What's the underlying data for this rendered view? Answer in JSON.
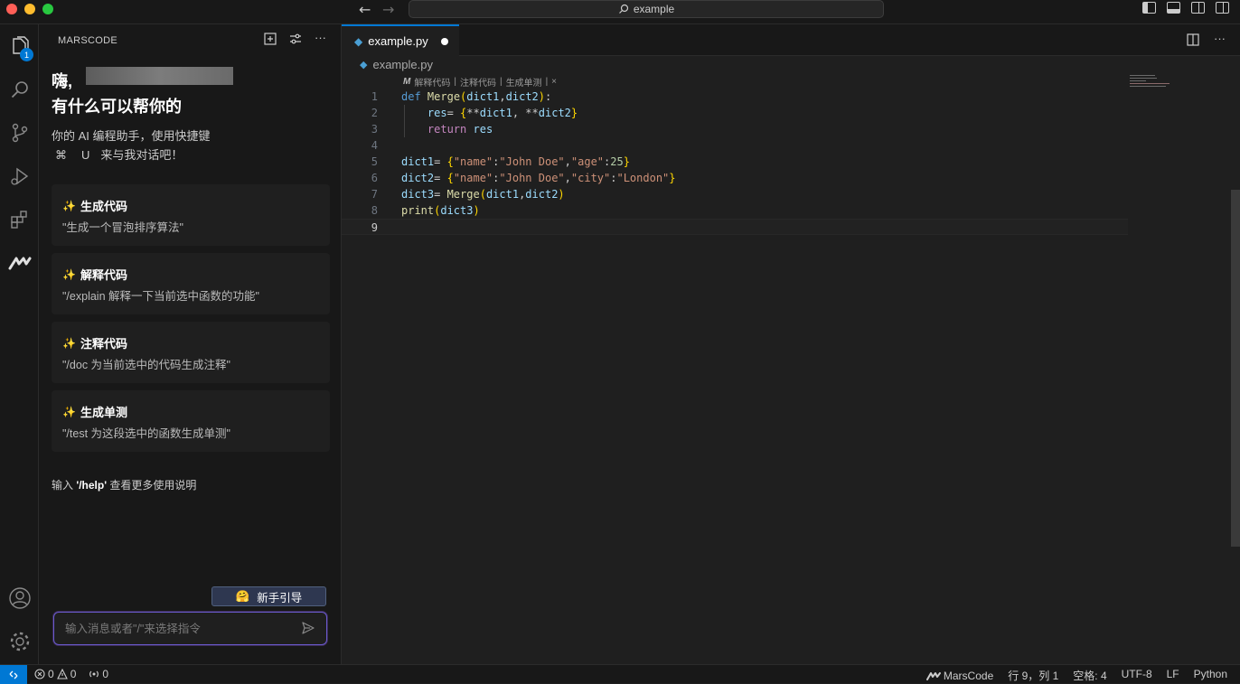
{
  "titlebar": {
    "search_text": "example",
    "back_icon": "arrow-left-icon",
    "forward_icon": "arrow-right-icon"
  },
  "activity_bar": {
    "explorer_badge": "1",
    "items": [
      "explorer-icon",
      "search-icon",
      "source-control-icon",
      "run-debug-icon",
      "extensions-icon",
      "marscode-icon"
    ],
    "bottom_items": [
      "account-icon",
      "settings-gear-icon"
    ]
  },
  "sidebar": {
    "title": "MARSCODE",
    "greeting": "嗨,",
    "greeting_line2": "有什么可以帮你的",
    "intro_line1": "你的 AI 编程助手，使用快捷键",
    "shortcut_symbol": "⌘",
    "shortcut_key": "U",
    "intro_line2_rest": "来与我对话吧！",
    "cards": [
      {
        "title": "生成代码",
        "desc": "\"生成一个冒泡排序算法\""
      },
      {
        "title": "解释代码",
        "desc": "\"/explain 解释一下当前选中函数的功能\""
      },
      {
        "title": "注释代码",
        "desc": "\"/doc 为当前选中的代码生成注释\""
      },
      {
        "title": "生成单测",
        "desc": "\"/test 为这段选中的函数生成单测\""
      }
    ],
    "help_prefix": "输入",
    "help_command": "'/help'",
    "help_suffix": "查看更多使用说明",
    "guide_button": "新手引导",
    "guide_emoji": "🤗",
    "chat_placeholder": "输入消息或者\"/\"来选择指令"
  },
  "editor": {
    "tab_label": "example.py",
    "breadcrumb_file": "example.py",
    "codelens": [
      "解释代码",
      "注释代码",
      "生成单测"
    ],
    "codelens_sep": "|",
    "codelens_close": "×",
    "line_numbers": [
      "1",
      "2",
      "3",
      "4",
      "5",
      "6",
      "7",
      "8",
      "9"
    ]
  },
  "statusbar": {
    "errors": "0",
    "warnings": "0",
    "ports": "0",
    "marscode": "MarsCode",
    "position": "行 9，列 1",
    "spaces": "空格: 4",
    "encoding": "UTF-8",
    "eol": "LF",
    "language": "Python"
  },
  "colors": {
    "accent": "#0078d4",
    "editor_bg": "#1f1f1f",
    "sidebar_bg": "#181818"
  }
}
